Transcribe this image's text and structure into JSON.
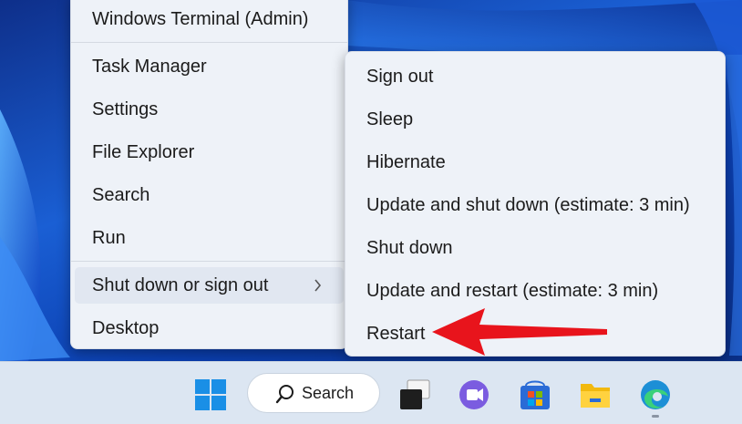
{
  "context_menu": {
    "items": [
      {
        "label": "Windows Terminal (Admin)"
      },
      {
        "label": "Task Manager"
      },
      {
        "label": "Settings"
      },
      {
        "label": "File Explorer"
      },
      {
        "label": "Search"
      },
      {
        "label": "Run"
      },
      {
        "label": "Shut down or sign out",
        "has_submenu": true,
        "icon": "chevron-right-icon"
      },
      {
        "label": "Desktop"
      }
    ]
  },
  "submenu": {
    "items": [
      {
        "label": "Sign out"
      },
      {
        "label": "Sleep"
      },
      {
        "label": "Hibernate"
      },
      {
        "label": "Update and shut down (estimate: 3 min)"
      },
      {
        "label": "Shut down"
      },
      {
        "label": "Update and restart (estimate: 3 min)"
      },
      {
        "label": "Restart"
      }
    ]
  },
  "annotation": {
    "icon": "red-arrow-icon",
    "color": "#e8141c",
    "points_to": "Restart"
  },
  "taskbar": {
    "search_label": "Search",
    "icons": [
      "windows-start-icon",
      "search-icon",
      "task-view-icon",
      "chat-icon",
      "microsoft-store-icon",
      "file-explorer-icon",
      "edge-icon"
    ]
  },
  "colors": {
    "menu_bg": "#eef2f8",
    "taskbar_bg": "#dce6f2",
    "accent_blue": "#0067c0"
  }
}
